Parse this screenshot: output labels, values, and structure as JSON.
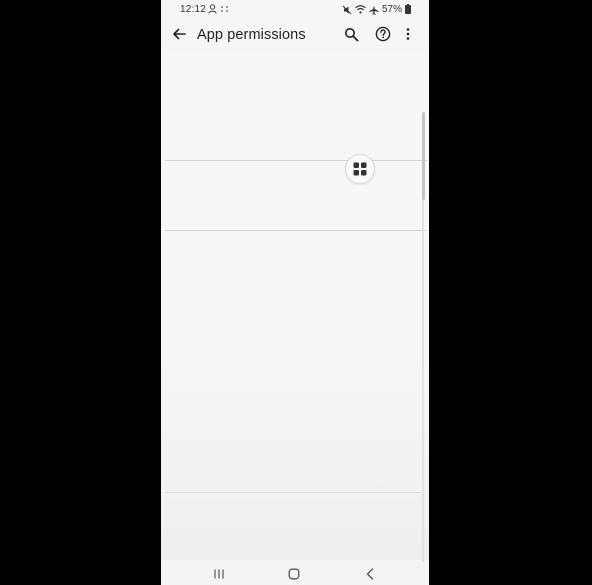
{
  "status_bar": {
    "time": "12:12",
    "battery": "57%",
    "icons": [
      "user-icon",
      "dots-icon",
      "mute-icon",
      "wifi-icon",
      "airplane-icon",
      "battery-icon"
    ]
  },
  "app_bar": {
    "title": "App permissions",
    "icons": [
      "back-arrow-icon",
      "search-icon",
      "help-icon",
      "more-vert-icon"
    ]
  },
  "floating_button": {
    "icon": "grid-view-icon"
  },
  "nav_bar": {
    "icons": [
      "recent-apps-icon",
      "home-icon",
      "back-nav-icon"
    ]
  },
  "colors": {
    "background": "#f6f6f6",
    "outer": "#000000",
    "text": "#222222",
    "divider": "#d6d6d6"
  }
}
